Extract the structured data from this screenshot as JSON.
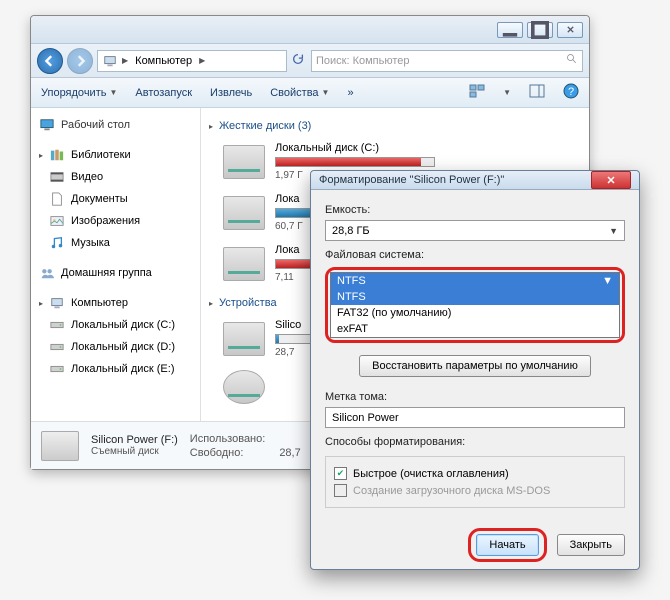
{
  "explorer": {
    "breadcrumb": [
      "Компьютер"
    ],
    "search_placeholder": "Поиск: Компьютер",
    "toolbar": {
      "organize": "Упорядочить",
      "autoplay": "Автозапуск",
      "eject": "Извлечь",
      "properties": "Свойства"
    },
    "sidebar": {
      "desktop": "Рабочий стол",
      "libraries": "Библиотеки",
      "videos": "Видео",
      "documents": "Документы",
      "pictures": "Изображения",
      "music": "Музыка",
      "homegroup": "Домашняя группа",
      "computer": "Компьютер",
      "drive_c": "Локальный диск (C:)",
      "drive_d": "Локальный диск (D:)",
      "drive_e": "Локальный диск (E:)"
    },
    "sections": {
      "hdd_header": "Жесткие диски (3)",
      "devices_header": "Устройства"
    },
    "drives": [
      {
        "label": "Локальный диск (C:)",
        "info": "1,97 Г",
        "fill": 92,
        "color": "red"
      },
      {
        "label": "Лока",
        "info": "60,7 Г",
        "fill": 45,
        "color": "blue"
      },
      {
        "label": "Лока",
        "info": "7,11",
        "fill": 95,
        "color": "red"
      }
    ],
    "device_rows": [
      {
        "label": "Silico",
        "info": "28,7"
      }
    ],
    "status": {
      "title": "Silicon Power (F:)",
      "subtitle": "Съемный диск",
      "used_label": "Использовано:",
      "free_label": "Свободно:",
      "free_value": "28,7"
    }
  },
  "dialog": {
    "title": "Форматирование \"Silicon Power (F:)\"",
    "capacity_label": "Емкость:",
    "capacity_value": "28,8 ГБ",
    "fs_label": "Файловая система:",
    "fs_selected": "NTFS",
    "fs_options": [
      "NTFS",
      "FAT32 (по умолчанию)",
      "exFAT"
    ],
    "restore_defaults": "Восстановить параметры по умолчанию",
    "volume_label": "Метка тома:",
    "volume_value": "Silicon Power",
    "methods_label": "Способы форматирования:",
    "quick": "Быстрое (очистка оглавления)",
    "msdos": "Создание загрузочного диска MS-DOS",
    "start": "Начать",
    "close": "Закрыть"
  }
}
